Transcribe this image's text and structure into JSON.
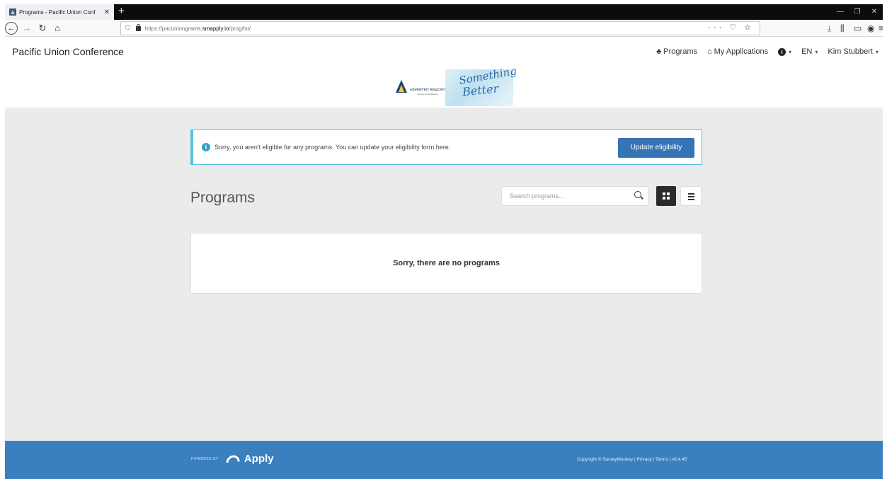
{
  "browser": {
    "tab_title": "Programs - Pacific Union Conf",
    "tab_close": "✕",
    "new_tab": "+",
    "url_prefix": "https://pacuniongrants.",
    "url_host": "smapply.io",
    "url_path": "/prog/lst/",
    "url_actions": "··· ♡ ☆",
    "icons": [
      "back-icon",
      "forward-icon",
      "reload-icon",
      "home-icon",
      "shield-icon",
      "lock-icon",
      "download-icon",
      "library-icon",
      "sidebar-icon",
      "account-icon",
      "menu-icon"
    ]
  },
  "header": {
    "brand": "Pacific Union Conference",
    "nav": {
      "programs": "Programs",
      "my_applications": "My Applications",
      "language": "EN",
      "user": "Kim Stubbert"
    },
    "logo": {
      "org": "ADVENTIST EDUCATION",
      "tagline": "Journey to Excellence",
      "script_1": "Something",
      "script_2": "Better"
    }
  },
  "alert": {
    "text": "Sorry, you aren't eligible for any programs. You can update your eligibility form here.",
    "button": "Update eligibility"
  },
  "programs": {
    "title": "Programs",
    "search_placeholder": "Search programs...",
    "view_mode": "grid",
    "empty_message": "Sorry, there are no programs"
  },
  "footer": {
    "powered_by": "POWERED BY",
    "product": "Apply",
    "copyright": "Copyright © SurveyMonkey | Privacy | Terms | v6.4.45"
  },
  "colors": {
    "primary": "#3675b5",
    "footer": "#3a80bf",
    "alert_border": "#5bc0de",
    "page_bg": "#ebebeb"
  }
}
